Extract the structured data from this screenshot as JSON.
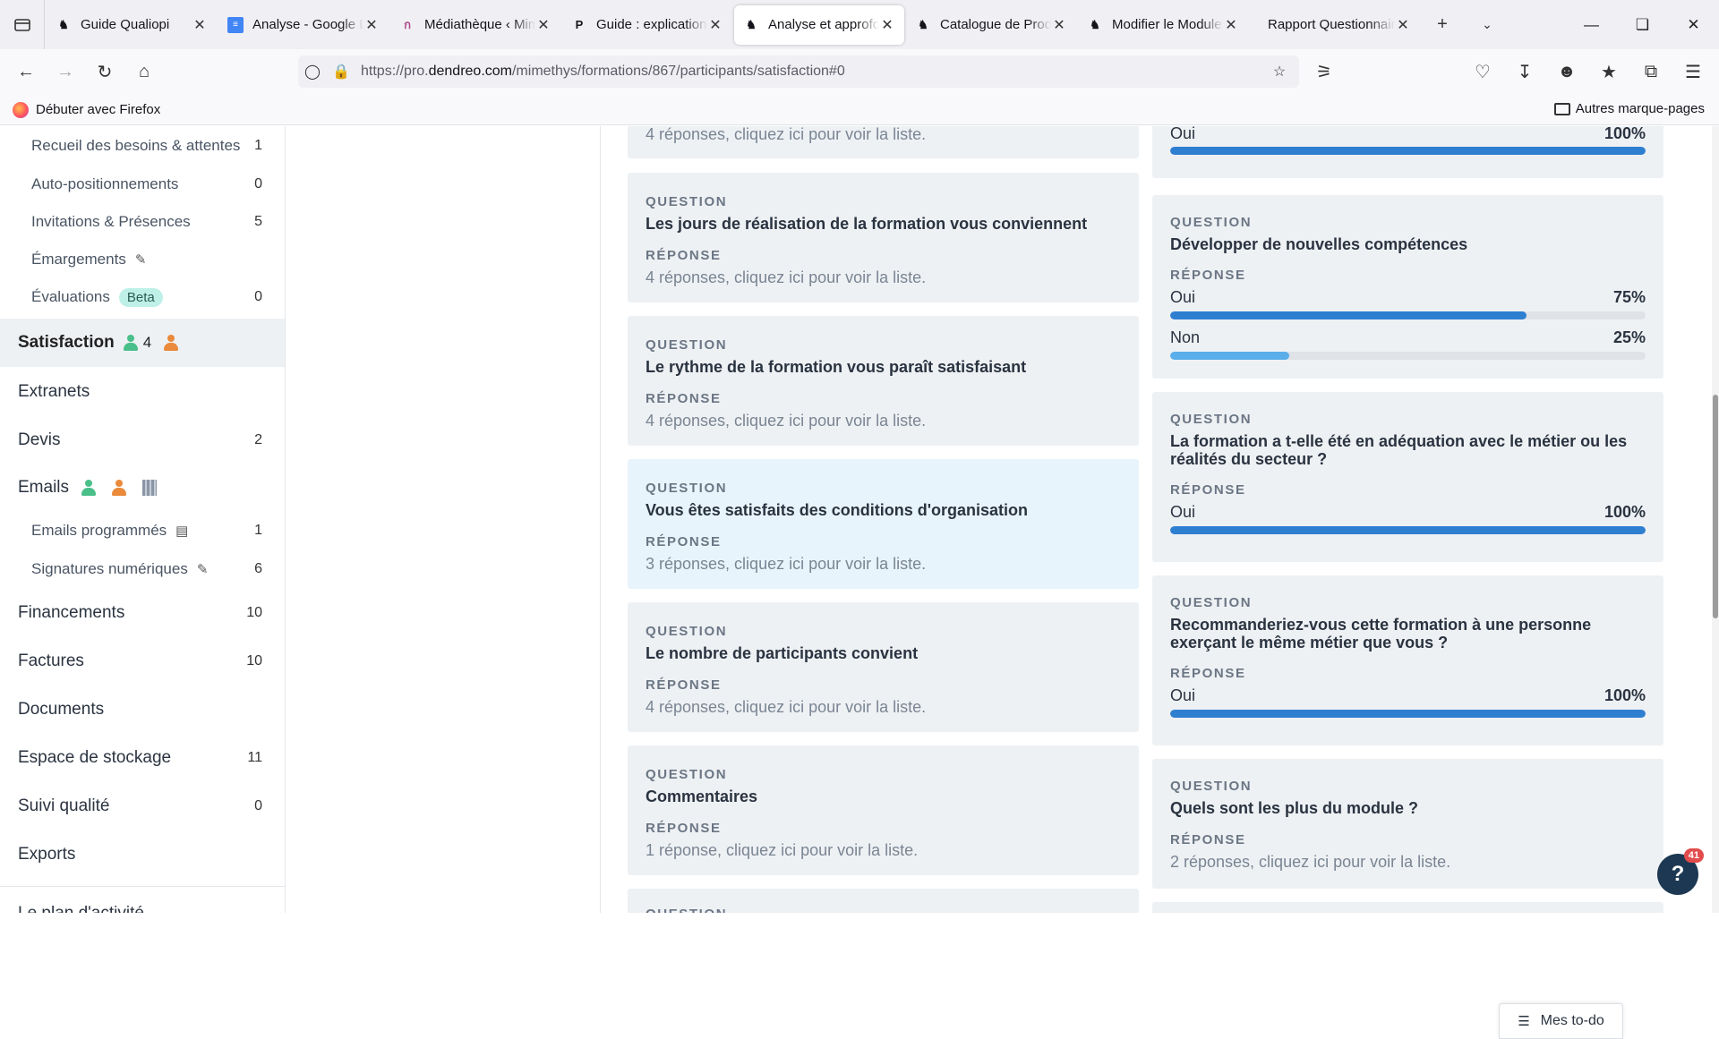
{
  "tabs": [
    {
      "label": "Guide Qualiopi",
      "favicon": "dendreo-icon",
      "active": false
    },
    {
      "label": "Analyse - Google Docs",
      "favicon": "gdocs-icon",
      "active": false
    },
    {
      "label": "Médiathèque ‹ Mimethys",
      "favicon": "wordpress-icon",
      "active": false
    },
    {
      "label": "Guide : explications",
      "favicon": "p-icon",
      "active": false
    },
    {
      "label": "Analyse et approfondissement",
      "favicon": "dendreo-icon",
      "active": true
    },
    {
      "label": "Catalogue de Produits",
      "favicon": "dendreo-icon",
      "active": false
    },
    {
      "label": "Modifier le Module",
      "favicon": "dendreo-icon",
      "active": false
    },
    {
      "label": "Rapport Questionnaire",
      "favicon": "none",
      "active": false
    }
  ],
  "nav": {
    "url_prefix": "https://pro.",
    "url_domain": "dendreo.com",
    "url_path": "/mimethys/formations/867/participants/satisfaction#0"
  },
  "bookmarks": {
    "first": "Débuter avec Firefox",
    "other": "Autres marque-pages"
  },
  "sidebar": {
    "items": [
      {
        "label": "Recueil des besoins & attentes",
        "count": "1"
      },
      {
        "label": "Auto-positionnements",
        "count": "0"
      },
      {
        "label": "Invitations & Présences",
        "count": "5"
      },
      {
        "label": "Émargements",
        "count": ""
      },
      {
        "label": "Évaluations",
        "badge": "Beta",
        "count": "0"
      },
      {
        "label": "Satisfaction",
        "count": "4"
      },
      {
        "label": "Extranets",
        "count": ""
      },
      {
        "label": "Devis",
        "count": "2"
      },
      {
        "label": "Emails",
        "count": ""
      },
      {
        "label": "Emails programmés",
        "count": "1"
      },
      {
        "label": "Signatures numériques",
        "count": "6"
      },
      {
        "label": "Financements",
        "count": "10"
      },
      {
        "label": "Factures",
        "count": "10"
      },
      {
        "label": "Documents",
        "count": ""
      },
      {
        "label": "Espace de stockage",
        "count": "11"
      },
      {
        "label": "Suivi qualité",
        "count": "0"
      },
      {
        "label": "Exports",
        "count": ""
      },
      {
        "label": "Le plan d'activité",
        "count": ""
      }
    ]
  },
  "labels": {
    "question": "QUESTION",
    "reponse": "RÉPONSE"
  },
  "left_cards": [
    {
      "question": "",
      "answer": "4 réponses, cliquez ici pour voir la liste."
    },
    {
      "question": "Les jours de réalisation de la formation vous conviennent",
      "answer": "4 réponses, cliquez ici pour voir la liste."
    },
    {
      "question": "Le rythme de la formation vous paraît satisfaisant",
      "answer": "4 réponses, cliquez ici pour voir la liste."
    },
    {
      "question": "Vous êtes satisfaits des conditions d'organisation",
      "answer": "3 réponses, cliquez ici pour voir la liste."
    },
    {
      "question": "Le nombre de participants convient",
      "answer": "4 réponses, cliquez ici pour voir la liste."
    },
    {
      "question": "Commentaires",
      "answer": "1 réponse, cliquez ici pour voir la liste."
    }
  ],
  "right_cards": [
    {
      "question": "",
      "options": [
        {
          "label": "Oui",
          "pct": "100%",
          "value": 1.0
        }
      ]
    },
    {
      "question": "Développer de nouvelles compétences",
      "options": [
        {
          "label": "Oui",
          "pct": "75%",
          "value": 0.75
        },
        {
          "label": "Non",
          "pct": "25%",
          "value": 0.25
        }
      ]
    },
    {
      "question": "La formation a t-elle été en adéquation avec le métier ou les réalités du secteur ?",
      "options": [
        {
          "label": "Oui",
          "pct": "100%",
          "value": 1.0
        }
      ]
    },
    {
      "question": "Recommanderiez-vous cette formation à une personne exerçant le même métier que vous ?",
      "options": [
        {
          "label": "Oui",
          "pct": "100%",
          "value": 1.0
        }
      ]
    },
    {
      "question": "Quels sont les plus du module ?",
      "answer": "2 réponses, cliquez ici pour voir la liste."
    }
  ],
  "todo": "Mes to-do",
  "help_badge": "41",
  "colors": {
    "bar_primary": "#2f7fd1",
    "bar_secondary": "#5aaeea",
    "card_bg": "#eef1f4",
    "card_highlight": "#e8f4fb"
  }
}
